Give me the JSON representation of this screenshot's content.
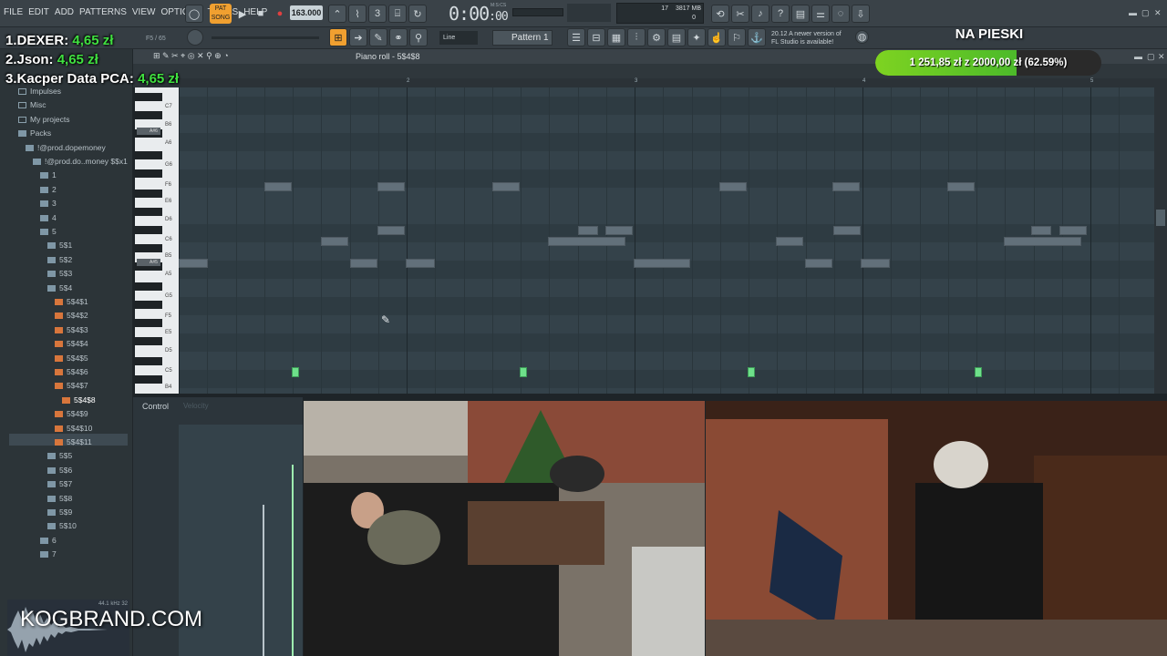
{
  "menu": [
    "FILE",
    "EDIT",
    "ADD",
    "PATTERNS",
    "VIEW",
    "OPTIONS",
    "TOOLS",
    "HELP"
  ],
  "transport": {
    "pat_label": "PAT",
    "song_label": "SONG",
    "tempo": "163.000",
    "time": "0:00",
    "time_small": ":00",
    "time_unit": "M:S:CS"
  },
  "cpu": {
    "value_a": "17",
    "memory": "3817 MB",
    "value_c": "0"
  },
  "toolbar2": {
    "position": "F5 / 65",
    "line_mode": "Line",
    "pattern": "Pattern 1",
    "newer_version_line1": "20.12  A newer version of",
    "newer_version_line2": "FL Studio is available!"
  },
  "piano_roll": {
    "title": "Piano roll - 5$4$8",
    "bars": [
      "2",
      "3",
      "4",
      "5"
    ],
    "key_labels": [
      "C7",
      "B6",
      "A6",
      "G6",
      "F6",
      "E6",
      "D6",
      "C6",
      "B5",
      "A5",
      "G5",
      "F5",
      "E5",
      "D5",
      "C5",
      "B4"
    ],
    "marked_keys": [
      "A#6",
      "A#5"
    ],
    "control_label": "Control",
    "control_param": "Velocity"
  },
  "browser": {
    "items": [
      {
        "label": "Impulses",
        "indent": 1,
        "icon": "folder"
      },
      {
        "label": "Misc",
        "indent": 1,
        "icon": "folder"
      },
      {
        "label": "My projects",
        "indent": 1,
        "icon": "folder"
      },
      {
        "label": "Packs",
        "indent": 1,
        "icon": "folder-open"
      },
      {
        "label": "!@prod.dopemoney",
        "indent": 2,
        "icon": "folder-open"
      },
      {
        "label": "!@prod.do..money $$x1",
        "indent": 3,
        "icon": "folder-open"
      },
      {
        "label": "1",
        "indent": 4,
        "icon": "folder-open"
      },
      {
        "label": "2",
        "indent": 4,
        "icon": "folder-open"
      },
      {
        "label": "3",
        "indent": 4,
        "icon": "folder-open"
      },
      {
        "label": "4",
        "indent": 4,
        "icon": "folder-open"
      },
      {
        "label": "5",
        "indent": 4,
        "icon": "folder-open"
      },
      {
        "label": "5$1",
        "indent": 5,
        "icon": "folder-open"
      },
      {
        "label": "5$2",
        "indent": 5,
        "icon": "folder-open"
      },
      {
        "label": "5$3",
        "indent": 5,
        "icon": "folder-open"
      },
      {
        "label": "5$4",
        "indent": 5,
        "icon": "folder-open"
      },
      {
        "label": "5$4$1",
        "indent": 6,
        "icon": "orange"
      },
      {
        "label": "5$4$2",
        "indent": 6,
        "icon": "orange"
      },
      {
        "label": "5$4$3",
        "indent": 6,
        "icon": "orange"
      },
      {
        "label": "5$4$4",
        "indent": 6,
        "icon": "orange"
      },
      {
        "label": "5$4$5",
        "indent": 6,
        "icon": "orange"
      },
      {
        "label": "5$4$6",
        "indent": 6,
        "icon": "orange"
      },
      {
        "label": "5$4$7",
        "indent": 6,
        "icon": "orange"
      },
      {
        "label": "5$4$8",
        "indent": 7,
        "icon": "orange",
        "selected": true
      },
      {
        "label": "5$4$9",
        "indent": 6,
        "icon": "orange"
      },
      {
        "label": "5$4$10",
        "indent": 6,
        "icon": "orange"
      },
      {
        "label": "5$4$11",
        "indent": 6,
        "icon": "orange"
      },
      {
        "label": "5$5",
        "indent": 5,
        "icon": "folder-open"
      },
      {
        "label": "5$6",
        "indent": 5,
        "icon": "folder-open"
      },
      {
        "label": "5$7",
        "indent": 5,
        "icon": "folder-open"
      },
      {
        "label": "5$8",
        "indent": 5,
        "icon": "folder-open"
      },
      {
        "label": "5$9",
        "indent": 5,
        "icon": "folder-open"
      },
      {
        "label": "5$10",
        "indent": 5,
        "icon": "folder-open"
      },
      {
        "label": "6",
        "indent": 4,
        "icon": "folder-open"
      },
      {
        "label": "7",
        "indent": 4,
        "icon": "folder-open"
      }
    ],
    "waveform_info": "44.1 kHz 32"
  },
  "leaderboard": [
    {
      "rank": "1.",
      "name": "DEXER:",
      "amount": "4,65 zł"
    },
    {
      "rank": "2.",
      "name": "Json:",
      "amount": "4,65 zł"
    },
    {
      "rank": "3.",
      "name": "Kacper Data PCA:",
      "amount": "4,65 zł"
    }
  ],
  "goal": {
    "title": "NA PIESKI",
    "raised": "1 251,85 zł",
    "connector": "z",
    "target": "2000,00 zł",
    "percent_label": "(62.59%)",
    "fraction": 0.6259
  },
  "watermark": "KOGBRAND.COM",
  "colors": {
    "goal_fill": "#7ed321",
    "leader_amount": "#40e040",
    "pat_button": "#f0a030",
    "note_green": "#6ee08a"
  }
}
